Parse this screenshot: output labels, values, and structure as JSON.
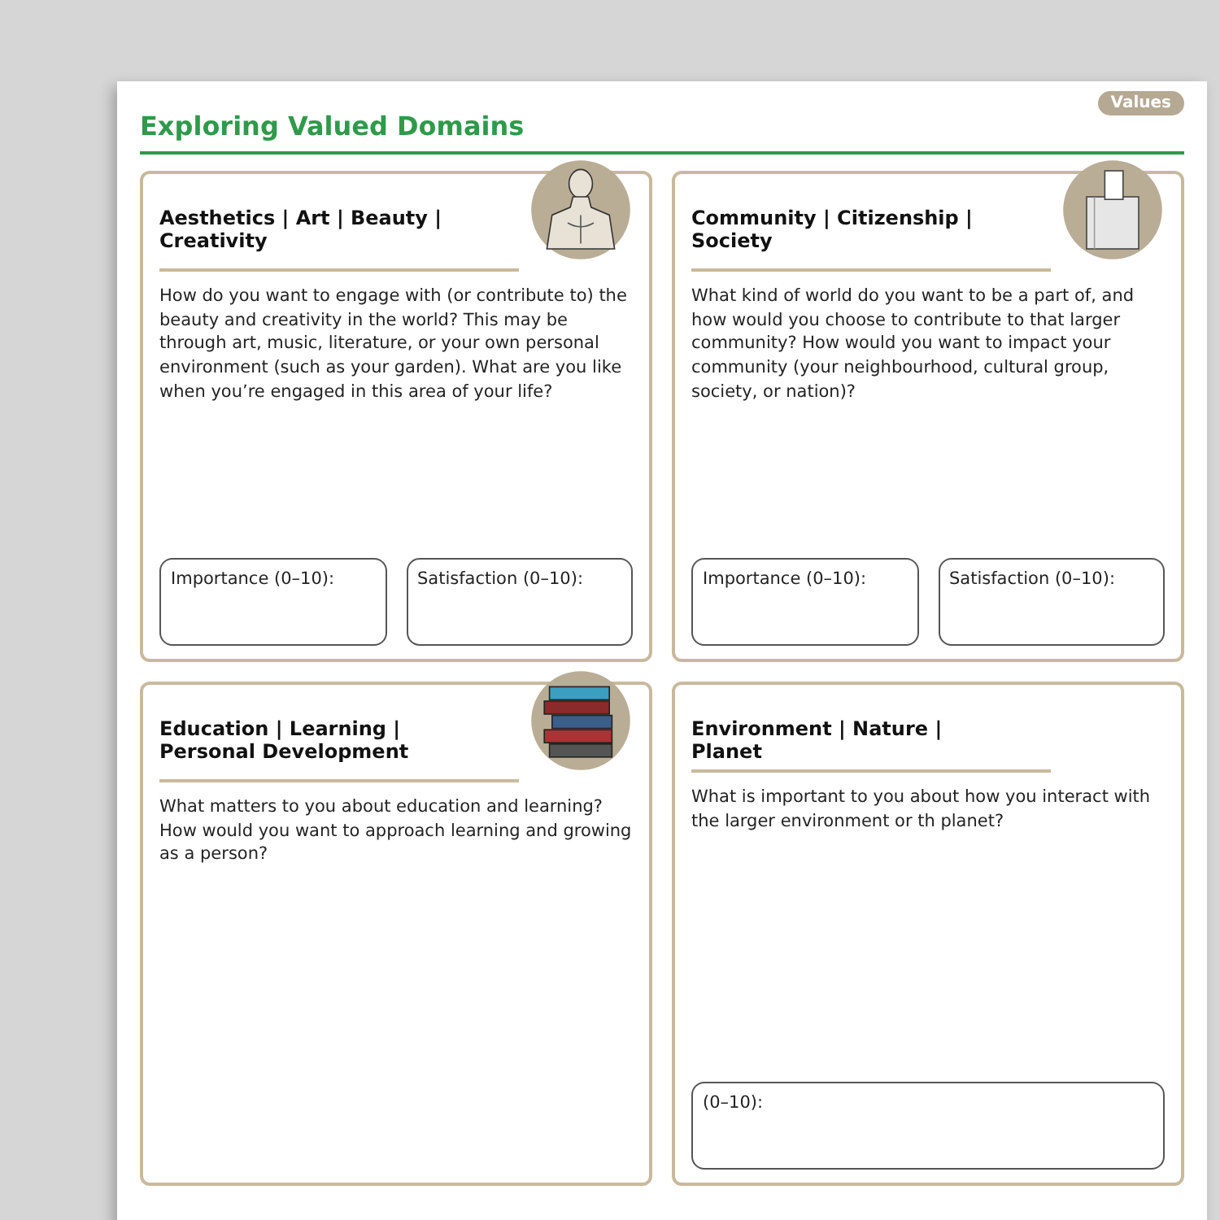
{
  "header": {
    "title": "Exploring Valued Domains",
    "badge": "Values"
  },
  "cards": [
    {
      "title": "Aesthetics | Art | Beauty | Creativity",
      "kind": "statue",
      "question": "How do you want to engage with (or contribute to) the beauty and creativity in the world? This may be through art, music, literature, or your own personal environment (such as your garden). What are you like when you’re engaged in this area of your life?",
      "ratings": [
        "Importance (0–10):",
        "Satisfaction (0–10):"
      ]
    },
    {
      "title": "Community | Citizenship | Society",
      "kind": "ballot",
      "question": "What kind of world do you want to be a part of, and how would you choose to contribute to that larger community? How would you want to impact your community (your neighbourhood, cultural group, society, or nation)?",
      "ratings": [
        "Importance (0–10):",
        "Satisfaction (0–10):"
      ]
    },
    {
      "title": "Education | Learning | Personal Development",
      "kind": "books",
      "question": "What matters to you about education and learning? How would you want to approach learning and growing as a person?"
    },
    {
      "title": "Environment | Nature | Planet",
      "kind": "plain",
      "question": "What is important to you about how you interact with the larger environment or th planet?",
      "ratings": [
        "(0–10):"
      ]
    }
  ]
}
